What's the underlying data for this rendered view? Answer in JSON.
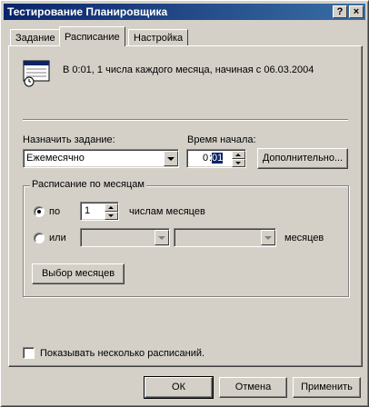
{
  "window": {
    "title": "Тестирование Планировщика",
    "help_button": "?",
    "close_button": "×"
  },
  "tabs": [
    {
      "label": "Задание"
    },
    {
      "label": "Расписание"
    },
    {
      "label": "Настройка"
    }
  ],
  "schedule": {
    "summary": "В 0:01, 1 числа каждого месяца, начиная с 06.03.2004",
    "assign_label": "Назначить задание:",
    "assign_value": "Ежемесячно",
    "start_time_label": "Время начала:",
    "start_time_hour": "0",
    "start_time_sep": ":",
    "start_time_min": "01",
    "advanced_button": "Дополнительно...",
    "monthly_group_title": "Расписание по месяцам",
    "radio_day_label": "по",
    "day_value": "1",
    "day_suffix": "числам месяцев",
    "radio_weekday_label": "или",
    "weekday_suffix": "месяцев",
    "select_months_button": "Выбор месяцев",
    "multiple_schedules_label": "Показывать несколько расписаний."
  },
  "footer": {
    "ok": "ОК",
    "cancel": "Отмена",
    "apply": "Применить"
  }
}
